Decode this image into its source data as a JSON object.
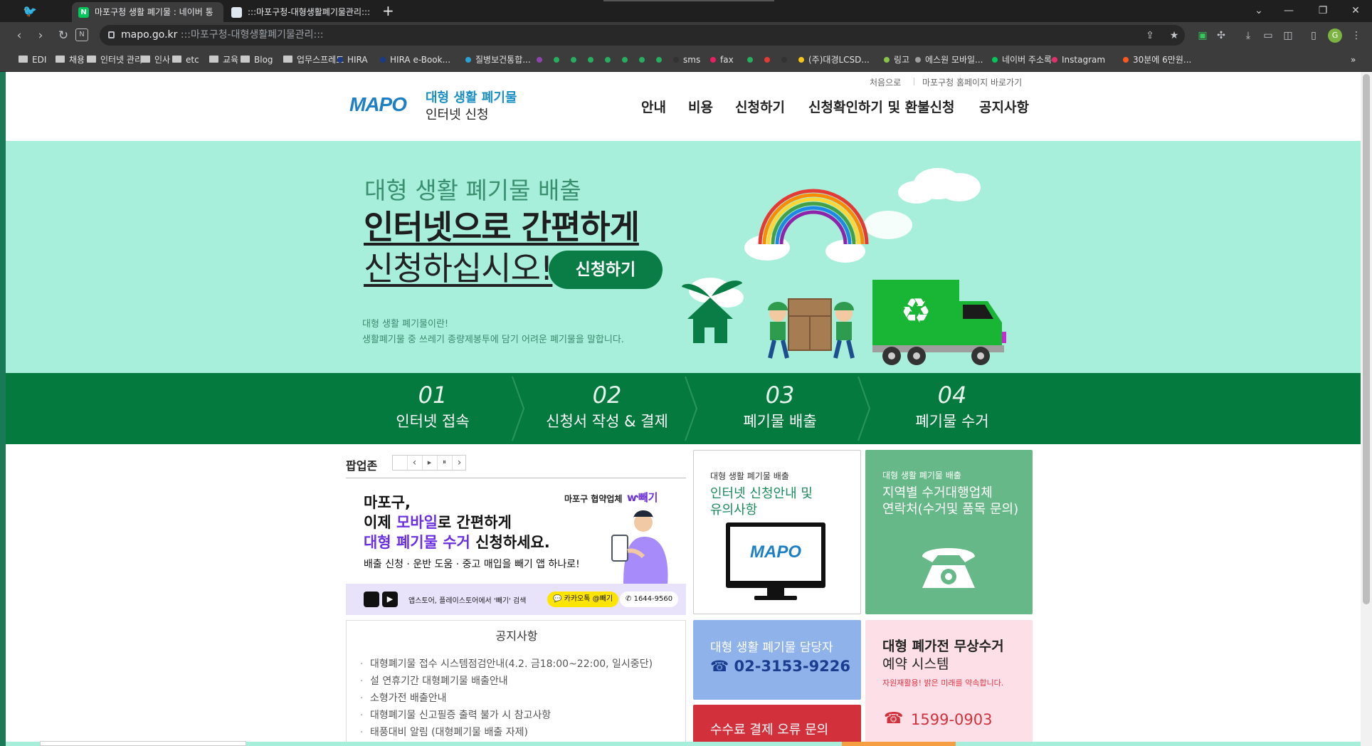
{
  "browser": {
    "tabs": [
      {
        "title": "마포구청 생활 폐기물 : 네이버 통",
        "favicon_color": "#03c75a",
        "favicon_letter": "N"
      },
      {
        "title": ":::마포구청-대형생활폐기물관리:::",
        "favicon_color": "#dfe8f0",
        "favicon_letter": ""
      }
    ],
    "new_tab": "+",
    "window_controls": {
      "dropdown": "⌄",
      "minimize": "—",
      "restore": "❐",
      "close": "✕"
    },
    "nav": {
      "back": "‹",
      "forward": "›",
      "reload": "↻",
      "site_icon": "N"
    },
    "address": {
      "host": "mapo.go.kr",
      "path": ":::마포구청-대형생활폐기물관리:::"
    },
    "bookmarks": [
      {
        "label": "EDI",
        "type": "folder"
      },
      {
        "label": "채용",
        "type": "folder"
      },
      {
        "label": "인터넷 관리",
        "type": "folder"
      },
      {
        "label": "인사",
        "type": "folder"
      },
      {
        "label": "etc",
        "type": "folder"
      },
      {
        "label": "교육",
        "type": "folder"
      },
      {
        "label": "Blog",
        "type": "folder"
      },
      {
        "label": "업무스프레드",
        "type": "folder"
      },
      {
        "label": "HIRA",
        "type": "dot",
        "color": "#1a3a8a"
      },
      {
        "label": "HIRA e-Book...",
        "type": "dot",
        "color": "#1a3a8a"
      },
      {
        "label": "질병보건통합...",
        "type": "dot",
        "color": "#29a3d6"
      },
      {
        "label": "",
        "type": "dot",
        "color": "#8e44ad"
      },
      {
        "label": "",
        "type": "dot",
        "color": "#27ae60"
      },
      {
        "label": "",
        "type": "dot",
        "color": "#27ae60"
      },
      {
        "label": "",
        "type": "dot",
        "color": "#27ae60"
      },
      {
        "label": "",
        "type": "dot",
        "color": "#27ae60"
      },
      {
        "label": "",
        "type": "dot",
        "color": "#27ae60"
      },
      {
        "label": "",
        "type": "dot",
        "color": "#27ae60"
      },
      {
        "label": "",
        "type": "dot",
        "color": "#27ae60"
      },
      {
        "label": "sms",
        "type": "dot",
        "color": "#333"
      },
      {
        "label": "fax",
        "type": "dot",
        "color": "#e91e63"
      },
      {
        "label": "",
        "type": "dot",
        "color": "#27ae60"
      },
      {
        "label": "",
        "type": "dot",
        "color": "#e53935"
      },
      {
        "label": "",
        "type": "dot",
        "color": "#333"
      },
      {
        "label": "(주)대경LCSD...",
        "type": "dot",
        "color": "#f5c518"
      },
      {
        "label": "링고",
        "type": "dot",
        "color": "#8bc34a"
      },
      {
        "label": "에스원 모바일...",
        "type": "dot",
        "color": "#9e9e9e"
      },
      {
        "label": "네이버 주소록",
        "type": "dot",
        "color": "#03c75a"
      },
      {
        "label": "Instagram",
        "type": "dot",
        "color": "#e1306c"
      },
      {
        "label": "30분에 6만원...",
        "type": "dot",
        "color": "#ff5722"
      }
    ],
    "bookmarks_more": "»"
  },
  "header": {
    "top_links": [
      "처음으로",
      "마포구청 홈페이지 바로가기"
    ],
    "logo": {
      "mark": "MAPO",
      "line1": "대형 생활 폐기물",
      "line2": "인터넷 신청"
    },
    "gnb": [
      "안내",
      "비용",
      "신청하기",
      "신청확인하기 및 환불신청",
      "공지사항"
    ]
  },
  "hero": {
    "sub": "대형 생활 폐기물 배출",
    "line1": "인터넷으로 간편하게",
    "line2": "신청하십시오!",
    "apply_button": "신청하기",
    "desc1": "대형 생활 폐기물이란!",
    "desc2": "생활폐기물 중 쓰레기 종량제봉투에 담기 어려운 폐기물을 말합니다."
  },
  "steps": [
    {
      "num": "01",
      "label": "인터넷 접속"
    },
    {
      "num": "02",
      "label": "신청서 작성 & 결제"
    },
    {
      "num": "03",
      "label": "폐기물 배출"
    },
    {
      "num": "04",
      "label": "폐기물 수거"
    }
  ],
  "popup": {
    "title": "팝업존",
    "controls": [
      "‹",
      "▸",
      "⏸",
      "›"
    ],
    "banner": {
      "partner_label": "마포구 협약업체",
      "partner_name": "빼기",
      "line1": "마포구,",
      "line2a": "이제 ",
      "line2b": "모바일",
      "line2c": "로 간편하게",
      "line3a": "대형 폐기물 수거",
      "line3b": " 신청하세요.",
      "line4": "배출 신청 · 운반 도움 · 중고 매입을 빼기 앱 하나로!",
      "store_text": "앱스토어, 플레이스토어에서 '빼기' 검색",
      "kakao": "카카오톡 @빼기",
      "phone": "1644-9560"
    }
  },
  "notice": {
    "title": "공지사항",
    "items": [
      "대형폐기물 접수 시스템점검안내(4.2. 금18:00~22:00, 일시중단)",
      "설 연휴기간 대형폐기물 배출안내",
      "소형가전 배출안내",
      "대형폐기물 신고필증 출력 불가 시 참고사항",
      "태풍대비 알림 (대형폐기물 배출 자제)"
    ]
  },
  "cards": {
    "guide": {
      "small": "대형 생활 폐기물 배출",
      "title1": "인터넷 신청안내 및",
      "title2": "유의사항",
      "screen_logo": "MAPO"
    },
    "contact": {
      "small": "대형 생활 폐기물 배출",
      "title1": "지역별 수거대행업체",
      "title2": "연락처(수거및 품목 문의)"
    },
    "manager": {
      "title": "대형 생활 폐기물 담당자",
      "phone": "☎ 02-3153-9226"
    },
    "payment": {
      "title": "수수료 결제 오류 문의"
    },
    "appliance": {
      "title1": "대형 폐가전 무상수거",
      "title2": "예약 시스템",
      "slogan": "자원재활용! 밝은 미래를 약속합니다.",
      "phone": "1599-0903"
    }
  },
  "colors": {
    "hero_bg": "#a7eedb",
    "steps_bg": "#047a3f",
    "brand_green": "#0c7d45",
    "card_contact": "#67b889",
    "card_manager": "#8fb2ea",
    "card_payment": "#d2313c",
    "card_appliance": "#fde0e7"
  }
}
